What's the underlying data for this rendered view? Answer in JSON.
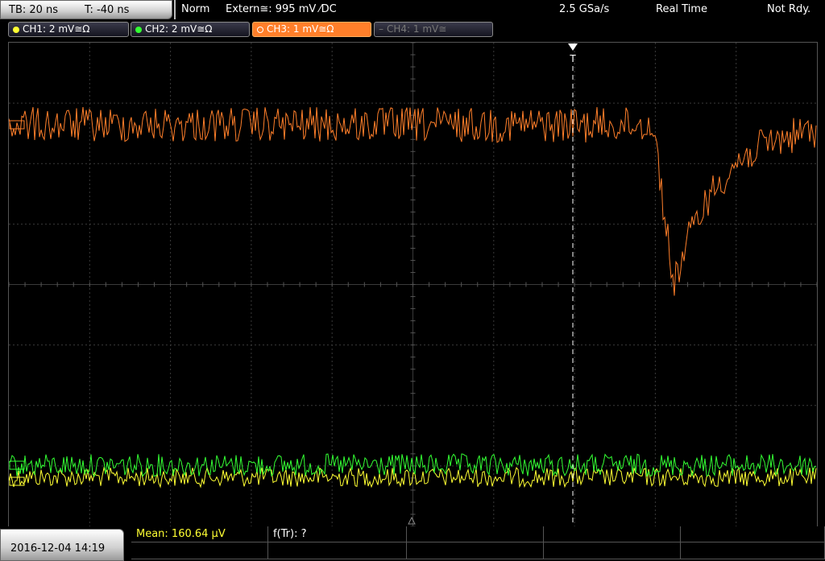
{
  "header": {
    "timebase": "TB: 20 ns",
    "trigger_time": "T: -40 ns",
    "mode": "Norm",
    "trigger_source": "Extern≅: 995 mV ⁄DC",
    "sample_rate": "2.5 GSa/s",
    "acq_mode": "Real Time",
    "status": "Not Rdy."
  },
  "channels": [
    {
      "label": "CH1: 2 mV≅Ω",
      "color": "#ffff33",
      "state": "on"
    },
    {
      "label": "CH2: 2 mV≅Ω",
      "color": "#33ff33",
      "state": "on"
    },
    {
      "label": "CH3: 1 mV≅Ω",
      "color": "#ff7f2a",
      "state": "active"
    },
    {
      "label": "CH4: 1 mV≅",
      "color": "#777777",
      "state": "off"
    }
  ],
  "trigger_marker": "T",
  "footer": {
    "datetime": "2016-12-04 14:19",
    "measurements": [
      {
        "label": "Mean: 160.64 µV",
        "color": "#ffff33"
      },
      {
        "label": "f(Tr): ?",
        "color": "#ffffff"
      }
    ]
  },
  "colors": {
    "ch1": "#ffff33",
    "ch2": "#33ff33",
    "ch3": "#ff7f2a",
    "grid": "#3a3a3a"
  }
}
